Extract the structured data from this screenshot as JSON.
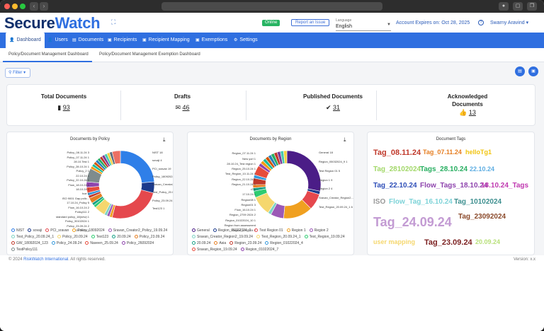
{
  "browser": {
    "back": "‹",
    "forward": "›"
  },
  "header": {
    "logo_a": "Secure",
    "logo_b": "Watch",
    "status": "Online",
    "report_issue": "Report an Issue",
    "language_label": "Language",
    "language_value": "English",
    "expires": "Account Expires on: Oct 28, 2025",
    "user": "Swarny Aravind"
  },
  "menu": [
    {
      "label": "Dashboard",
      "icon": "person-icon"
    },
    {
      "label": "Users",
      "icon": "users-icon"
    },
    {
      "label": "Documents",
      "icon": "document-icon"
    },
    {
      "label": "Recipients",
      "icon": "recipients-icon"
    },
    {
      "label": "Recipient Mapping",
      "icon": "mapping-icon"
    },
    {
      "label": "Exemptions",
      "icon": "exemptions-icon"
    },
    {
      "label": "Settings",
      "icon": "gear-icon"
    }
  ],
  "subtabs": [
    "Policy/Document Management Dashboard",
    "Policy/Document Management Exemption Dashboard"
  ],
  "filter": "Filter",
  "stats": [
    {
      "title": "Total Documents",
      "value": "93",
      "icon": "document-icon"
    },
    {
      "title": "Drafts",
      "value": "46",
      "icon": "inbox-icon"
    },
    {
      "title": "Published Documents",
      "value": "31",
      "icon": "check-circle-icon"
    },
    {
      "title": "Acknowledged Documents",
      "value": "13",
      "icon": "thumbs-up-icon"
    }
  ],
  "policy_chart": {
    "title": "Documents by Policy",
    "labels": [
      "NIST 18",
      "sovaji 4",
      "PCI_sravan 19",
      "Policy_18092024 1",
      "Sravan_Creator2_P...",
      "Test_Policy_20.09.24_1",
      "Policy_23.09.24 4",
      "Test123 1",
      "26.09.24 1",
      "Policy_23.09.24 2",
      "Policy_30102024 1",
      "standard policy_18(new) 1",
      "Policy111 2",
      "Flow_16.10.24 2",
      "17.10.24_Policy 5",
      "ISO 9001 Gap polic...",
      "hoe 1",
      "18.10.24 1",
      "Flow_18.10.24 1",
      "Policy_22.10.24 1",
      "22.10.24 1",
      "Policy_2 1",
      "Policy_28.10.24 1",
      "28.10.Test 1",
      "Policy_07.11.24 1",
      "Policy_08.11.24 3"
    ],
    "legend": [
      {
        "name": "NIST",
        "color": "#2f7fe8"
      },
      {
        "name": "sovaji",
        "color": "#1b3a8c"
      },
      {
        "name": "PCI_sravan",
        "color": "#e5484d"
      },
      {
        "name": "Policy_18092024",
        "color": "#f0a020"
      },
      {
        "name": "Sravan_Creator2_Policy_19.09.24",
        "color": "#9b59b6"
      },
      {
        "name": "Test_Policy_20.09.24_1",
        "color": "#7ed3c4"
      },
      {
        "name": "Policy_20.09.24",
        "color": "#f5d76e"
      },
      {
        "name": "Test123",
        "color": "#2ecc71"
      },
      {
        "name": "20.09.24",
        "color": "#16a085"
      },
      {
        "name": "Policy_23.09.24",
        "color": "#e67e22"
      },
      {
        "name": "GW_18092024_123",
        "color": "#c0392b"
      },
      {
        "name": "Policy_24.09.24",
        "color": "#3498db"
      },
      {
        "name": "Naveen_25.09.24",
        "color": "#e74c3c"
      },
      {
        "name": "Policy_26092024",
        "color": "#8e44ad"
      },
      {
        "name": "TestPolicy111",
        "color": "#7f8c8d"
      }
    ]
  },
  "region_chart": {
    "title": "Documents by Region",
    "labels": [
      "General 18",
      "Region_05032024_9 1",
      "Test Region 01 5",
      "Region 1 9",
      "Region 2 4",
      "Sravan_Creator_Region2...",
      "Test_Region_20.09.24_1 6",
      "Region_23.09.24 2",
      "Region from assessment",
      "Region_01022024_10 1",
      "Region_2709 2024 2",
      "Flow_16.10.24 1",
      "Region01 3",
      "Region08 1",
      "17.10.24 1",
      "r2 1",
      "Region_21.10.24 1",
      "Region_22.10.24 1",
      "Test_Region_10.11.24 1",
      "Region_25.10.24 1",
      "28.10.24_Test region 1",
      "New yorl 1",
      "Region_07.11.24 1"
    ],
    "legend": [
      {
        "name": "General",
        "color": "#4b1d87"
      },
      {
        "name": "Region_05032024_9",
        "color": "#1b3a8c"
      },
      {
        "name": "Test Region 01",
        "color": "#e5484d"
      },
      {
        "name": "Region 1",
        "color": "#f0a020"
      },
      {
        "name": "Region 2",
        "color": "#9b59b6"
      },
      {
        "name": "Sravan_Creator_Region2_19.09.24",
        "color": "#7ed3c4"
      },
      {
        "name": "Test_Region_20.09.24_1",
        "color": "#f5d76e"
      },
      {
        "name": "Test_Region_19.09.24",
        "color": "#2ecc71"
      },
      {
        "name": "20.09.24",
        "color": "#16a085"
      },
      {
        "name": "Asia",
        "color": "#e67e22"
      },
      {
        "name": "Region_23.09.24",
        "color": "#c0392b"
      },
      {
        "name": "Region_01022024_4",
        "color": "#3498db"
      },
      {
        "name": "Sravan_Region_19.09.24",
        "color": "#e74c3c"
      },
      {
        "name": "Region_01022024_7",
        "color": "#8e44ad"
      }
    ]
  },
  "tags": {
    "title": "Document Tags",
    "items": [
      {
        "text": "Tag_08.11.24",
        "color": "#c0392b"
      },
      {
        "text": "Tag_07.11.24",
        "color": "#e67e22"
      },
      {
        "text": "helloTg1",
        "color": "#f1c40f"
      },
      {
        "text": "Tag_28102024",
        "color": "#a3d86a"
      },
      {
        "text": "Tags_28.10.24",
        "color": "#27ae60"
      },
      {
        "text": "22.10.24",
        "color": "#5dade2"
      },
      {
        "text": "Tag_22.10.24",
        "color": "#2f4fb8"
      },
      {
        "text": "Flow_Tags_18.10.24",
        "color": "#8e44ad"
      },
      {
        "text": "18.10.24_Tags",
        "color": "#c039b0"
      },
      {
        "text": "ISO",
        "color": "#999999"
      },
      {
        "text": "Flow_Tag_16.10.24",
        "color": "#7ed3d8"
      },
      {
        "text": "Tag_10102024",
        "color": "#3d8f8f"
      },
      {
        "text": "Tag_24.09.24",
        "color": "#c39bd3"
      },
      {
        "text": "Tag_23092024",
        "color": "#8b4a2b"
      },
      {
        "text": "user mapping",
        "color": "#f5d76e"
      },
      {
        "text": "Tag_23.09.24",
        "color": "#7b1f1f"
      },
      {
        "text": "20.09.24",
        "color": "#b8e07a"
      }
    ]
  },
  "footer": {
    "copy_a": "© 2024",
    "company": "RiskWatch International",
    "copy_b": ". All rights reserved.",
    "version": "Version: x.x"
  }
}
